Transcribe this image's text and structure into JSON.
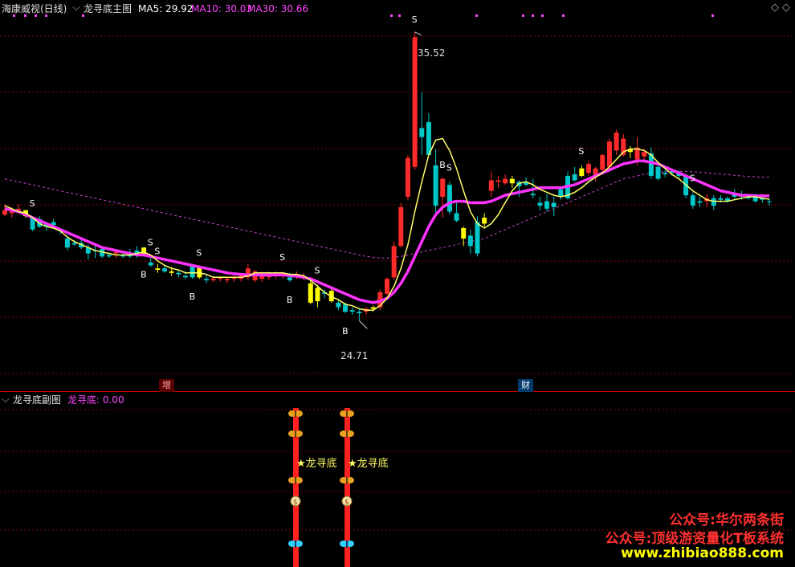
{
  "main_header": {
    "stock_label": "海康威视(日线)",
    "indicator_name": "龙寻底主图",
    "ma5_label": "MA5: 29.92",
    "ma10_label": "MA10: 30.03",
    "ma30_label": "MA30: 30.66"
  },
  "sub_header": {
    "indicator_name": "龙寻底副图",
    "value_label": "龙寻底: 0.00"
  },
  "markers": {
    "high_label": "35.52",
    "low_label": "24.71",
    "zeng_badge": "增",
    "cai_badge": "财",
    "sub_label_1": "★龙寻底",
    "sub_label_2": "★龙寻底"
  },
  "watermark": {
    "line1": "公众号:华尔两条街",
    "line2": "公众号:顶级游资量化T板系统",
    "line3": "www.zhibiao888.com"
  },
  "colors": {
    "up": "#ff2a2a",
    "down": "#00c8c8",
    "yellow_candle": "#ffff00",
    "ma5": "#ffff66",
    "ma10": "#ff33ff",
    "ma30": "#cc44cc",
    "grid": "#8b0000",
    "header_purple": "#ff44ff",
    "watermark_red": "#ff3030",
    "watermark_yellow": "#ffff00"
  },
  "chart_data": {
    "type": "candlestick",
    "title": "龙寻底主图",
    "ylim": [
      24,
      36
    ],
    "candles": [
      {
        "o": 29.55,
        "h": 29.75,
        "l": 29.35,
        "c": 29.4,
        "t": "up"
      },
      {
        "o": 29.5,
        "h": 29.65,
        "l": 29.3,
        "c": 29.45,
        "t": "up"
      },
      {
        "o": 29.55,
        "h": 29.75,
        "l": 29.5,
        "c": 29.6,
        "t": "up"
      },
      {
        "o": 29.35,
        "h": 29.55,
        "l": 29.3,
        "c": 29.55,
        "t": "yellow"
      },
      {
        "o": 29.3,
        "h": 29.3,
        "l": 28.85,
        "c": 28.9,
        "t": "down"
      },
      {
        "o": 29.25,
        "h": 29.35,
        "l": 28.95,
        "c": 29.0,
        "t": "down"
      },
      {
        "o": 29.0,
        "h": 29.15,
        "l": 28.85,
        "c": 29.1,
        "t": "down"
      },
      {
        "o": 29.15,
        "h": 29.25,
        "l": 28.95,
        "c": 29.05,
        "t": "down"
      },
      {
        "o": 28.9,
        "h": 28.95,
        "l": 28.75,
        "c": 28.85,
        "t": "down"
      },
      {
        "o": 28.6,
        "h": 28.7,
        "l": 28.2,
        "c": 28.3,
        "t": "down"
      },
      {
        "o": 28.45,
        "h": 28.55,
        "l": 28.35,
        "c": 28.4,
        "t": "down"
      },
      {
        "o": 28.45,
        "h": 28.6,
        "l": 28.25,
        "c": 28.3,
        "t": "down"
      },
      {
        "o": 28.3,
        "h": 28.4,
        "l": 27.9,
        "c": 28.1,
        "t": "down"
      },
      {
        "o": 28.2,
        "h": 28.4,
        "l": 27.95,
        "c": 28.2,
        "t": "down"
      },
      {
        "o": 28.25,
        "h": 28.3,
        "l": 27.95,
        "c": 28.0,
        "t": "down"
      },
      {
        "o": 28.05,
        "h": 28.15,
        "l": 27.95,
        "c": 28.0,
        "t": "down"
      },
      {
        "o": 28.1,
        "h": 28.2,
        "l": 27.95,
        "c": 28.15,
        "t": "up"
      },
      {
        "o": 28.05,
        "h": 28.1,
        "l": 27.95,
        "c": 28.0,
        "t": "down"
      },
      {
        "o": 28.1,
        "h": 28.25,
        "l": 27.95,
        "c": 28.0,
        "t": "down"
      },
      {
        "o": 28.1,
        "h": 28.35,
        "l": 27.95,
        "c": 28.2,
        "t": "down"
      },
      {
        "o": 28.05,
        "h": 28.3,
        "l": 28.0,
        "c": 28.3,
        "t": "yellow"
      },
      {
        "o": 27.8,
        "h": 28.0,
        "l": 27.65,
        "c": 27.7,
        "t": "down"
      },
      {
        "o": 27.6,
        "h": 27.75,
        "l": 27.45,
        "c": 27.55,
        "t": "yellow"
      },
      {
        "o": 27.6,
        "h": 27.7,
        "l": 27.45,
        "c": 27.5,
        "t": "down"
      },
      {
        "o": 27.5,
        "h": 27.65,
        "l": 27.35,
        "c": 27.45,
        "t": "yellow"
      },
      {
        "o": 27.45,
        "h": 27.55,
        "l": 27.3,
        "c": 27.4,
        "t": "down"
      },
      {
        "o": 27.35,
        "h": 27.5,
        "l": 27.25,
        "c": 27.3,
        "t": "down"
      },
      {
        "o": 27.3,
        "h": 27.75,
        "l": 27.25,
        "c": 27.7,
        "t": "down"
      },
      {
        "o": 27.65,
        "h": 27.7,
        "l": 27.25,
        "c": 27.3,
        "t": "yellow"
      },
      {
        "o": 27.25,
        "h": 27.4,
        "l": 27.1,
        "c": 27.2,
        "t": "down"
      },
      {
        "o": 27.2,
        "h": 27.35,
        "l": 27.15,
        "c": 27.25,
        "t": "up"
      },
      {
        "o": 27.25,
        "h": 27.35,
        "l": 27.15,
        "c": 27.3,
        "t": "up"
      },
      {
        "o": 27.2,
        "h": 27.3,
        "l": 27.1,
        "c": 27.25,
        "t": "up"
      },
      {
        "o": 27.25,
        "h": 27.4,
        "l": 27.15,
        "c": 27.3,
        "t": "up"
      },
      {
        "o": 27.25,
        "h": 27.45,
        "l": 27.15,
        "c": 27.35,
        "t": "up"
      },
      {
        "o": 27.3,
        "h": 27.75,
        "l": 27.2,
        "c": 27.6,
        "t": "up"
      },
      {
        "o": 27.2,
        "h": 27.55,
        "l": 27.15,
        "c": 27.5,
        "t": "up"
      },
      {
        "o": 27.25,
        "h": 27.5,
        "l": 27.15,
        "c": 27.4,
        "t": "up"
      },
      {
        "o": 27.3,
        "h": 27.5,
        "l": 27.2,
        "c": 27.4,
        "t": "up"
      },
      {
        "o": 27.35,
        "h": 27.5,
        "l": 27.25,
        "c": 27.4,
        "t": "up"
      },
      {
        "o": 27.35,
        "h": 27.5,
        "l": 27.25,
        "c": 27.45,
        "t": "up"
      },
      {
        "o": 27.3,
        "h": 27.45,
        "l": 27.15,
        "c": 27.2,
        "t": "down"
      },
      {
        "o": 27.35,
        "h": 27.5,
        "l": 27.25,
        "c": 27.4,
        "t": "up"
      },
      {
        "o": 27.3,
        "h": 27.45,
        "l": 27.2,
        "c": 27.35,
        "t": "up"
      },
      {
        "o": 27.1,
        "h": 27.3,
        "l": 26.4,
        "c": 26.45,
        "t": "yellow"
      },
      {
        "o": 26.95,
        "h": 27.05,
        "l": 26.3,
        "c": 26.5,
        "t": "yellow"
      },
      {
        "o": 26.8,
        "h": 26.9,
        "l": 26.6,
        "c": 26.75,
        "t": "down"
      },
      {
        "o": 26.85,
        "h": 26.95,
        "l": 26.45,
        "c": 26.5,
        "t": "yellow"
      },
      {
        "o": 26.45,
        "h": 26.55,
        "l": 26.2,
        "c": 26.3,
        "t": "down"
      },
      {
        "o": 26.4,
        "h": 26.45,
        "l": 26.1,
        "c": 26.15,
        "t": "down"
      },
      {
        "o": 26.2,
        "h": 26.3,
        "l": 26.05,
        "c": 26.15,
        "t": "down"
      },
      {
        "o": 26.15,
        "h": 26.25,
        "l": 25.85,
        "c": 26.1,
        "t": "down"
      },
      {
        "o": 26.15,
        "h": 26.3,
        "l": 26.05,
        "c": 26.25,
        "t": "up"
      },
      {
        "o": 26.25,
        "h": 26.35,
        "l": 26.15,
        "c": 26.3,
        "t": "yellow"
      },
      {
        "o": 26.3,
        "h": 26.9,
        "l": 26.2,
        "c": 26.8,
        "t": "up"
      },
      {
        "o": 26.75,
        "h": 27.3,
        "l": 26.7,
        "c": 27.25,
        "t": "up"
      },
      {
        "o": 27.3,
        "h": 28.5,
        "l": 27.2,
        "c": 28.35,
        "t": "up"
      },
      {
        "o": 28.35,
        "h": 29.8,
        "l": 28.3,
        "c": 29.65,
        "t": "up"
      },
      {
        "o": 30.0,
        "h": 31.4,
        "l": 29.9,
        "c": 31.3,
        "t": "up"
      },
      {
        "o": 31.0,
        "h": 35.52,
        "l": 30.9,
        "c": 35.35,
        "t": "up"
      },
      {
        "o": 32.3,
        "h": 33.5,
        "l": 31.4,
        "c": 32.0,
        "t": "down"
      },
      {
        "o": 32.5,
        "h": 32.8,
        "l": 31.35,
        "c": 31.4,
        "t": "down"
      },
      {
        "o": 31.05,
        "h": 31.6,
        "l": 29.4,
        "c": 29.7,
        "t": "down"
      },
      {
        "o": 30.0,
        "h": 30.65,
        "l": 29.3,
        "c": 30.6,
        "t": "up"
      },
      {
        "o": 30.4,
        "h": 30.5,
        "l": 29.4,
        "c": 29.5,
        "t": "down"
      },
      {
        "o": 29.45,
        "h": 29.8,
        "l": 29.15,
        "c": 29.2,
        "t": "down"
      },
      {
        "o": 28.95,
        "h": 29.0,
        "l": 28.35,
        "c": 28.6,
        "t": "yellow"
      },
      {
        "o": 28.7,
        "h": 28.9,
        "l": 28.1,
        "c": 28.35,
        "t": "down"
      },
      {
        "o": 28.1,
        "h": 29.35,
        "l": 28.0,
        "c": 29.15,
        "t": "down"
      },
      {
        "o": 29.3,
        "h": 29.45,
        "l": 29.0,
        "c": 29.1,
        "t": "yellow"
      },
      {
        "o": 30.2,
        "h": 30.85,
        "l": 30.0,
        "c": 30.55,
        "t": "up"
      },
      {
        "o": 30.55,
        "h": 30.7,
        "l": 30.3,
        "c": 30.5,
        "t": "up"
      },
      {
        "o": 30.45,
        "h": 30.75,
        "l": 30.4,
        "c": 30.6,
        "t": "up"
      },
      {
        "o": 30.6,
        "h": 30.7,
        "l": 30.3,
        "c": 30.45,
        "t": "yellow"
      },
      {
        "o": 30.5,
        "h": 30.55,
        "l": 30.0,
        "c": 30.35,
        "t": "down"
      },
      {
        "o": 30.4,
        "h": 30.65,
        "l": 30.35,
        "c": 30.5,
        "t": "down"
      },
      {
        "o": 30.1,
        "h": 30.6,
        "l": 29.95,
        "c": 30.05,
        "t": "down"
      },
      {
        "o": 29.8,
        "h": 30.0,
        "l": 29.55,
        "c": 29.7,
        "t": "down"
      },
      {
        "o": 29.85,
        "h": 30.1,
        "l": 29.5,
        "c": 29.6,
        "t": "down"
      },
      {
        "o": 29.65,
        "h": 30.0,
        "l": 29.35,
        "c": 29.8,
        "t": "down"
      },
      {
        "o": 30.0,
        "h": 30.35,
        "l": 29.9,
        "c": 30.25,
        "t": "down"
      },
      {
        "o": 29.95,
        "h": 30.85,
        "l": 29.9,
        "c": 30.7,
        "t": "down"
      },
      {
        "o": 30.75,
        "h": 31.0,
        "l": 30.5,
        "c": 30.55,
        "t": "down"
      },
      {
        "o": 30.7,
        "h": 31.05,
        "l": 30.65,
        "c": 30.95,
        "t": "yellow"
      },
      {
        "o": 30.8,
        "h": 31.2,
        "l": 30.7,
        "c": 31.1,
        "t": "up"
      },
      {
        "o": 30.7,
        "h": 31.0,
        "l": 30.5,
        "c": 30.95,
        "t": "up"
      },
      {
        "o": 30.9,
        "h": 31.45,
        "l": 30.8,
        "c": 31.4,
        "t": "up"
      },
      {
        "o": 31.0,
        "h": 31.95,
        "l": 30.95,
        "c": 31.85,
        "t": "up"
      },
      {
        "o": 31.55,
        "h": 32.25,
        "l": 31.4,
        "c": 32.15,
        "t": "up"
      },
      {
        "o": 31.4,
        "h": 32.1,
        "l": 31.35,
        "c": 31.95,
        "t": "up"
      },
      {
        "o": 31.5,
        "h": 31.7,
        "l": 31.3,
        "c": 31.6,
        "t": "yellow"
      },
      {
        "o": 31.65,
        "h": 32.0,
        "l": 31.05,
        "c": 31.25,
        "t": "up"
      },
      {
        "o": 31.35,
        "h": 31.6,
        "l": 31.25,
        "c": 31.5,
        "t": "up"
      },
      {
        "o": 31.45,
        "h": 31.65,
        "l": 30.6,
        "c": 30.7,
        "t": "down"
      },
      {
        "o": 31.0,
        "h": 31.15,
        "l": 30.55,
        "c": 30.6,
        "t": "down"
      },
      {
        "o": 30.8,
        "h": 30.9,
        "l": 30.65,
        "c": 30.75,
        "t": "down"
      },
      {
        "o": 30.85,
        "h": 30.95,
        "l": 30.7,
        "c": 30.8,
        "t": "down"
      },
      {
        "o": 30.8,
        "h": 30.9,
        "l": 30.6,
        "c": 30.7,
        "t": "down"
      },
      {
        "o": 30.7,
        "h": 30.75,
        "l": 29.95,
        "c": 30.05,
        "t": "down"
      },
      {
        "o": 30.05,
        "h": 30.15,
        "l": 29.6,
        "c": 29.7,
        "t": "down"
      },
      {
        "o": 29.85,
        "h": 30.0,
        "l": 29.65,
        "c": 29.8,
        "t": "down"
      },
      {
        "o": 29.85,
        "h": 30.1,
        "l": 29.65,
        "c": 29.95,
        "t": "up"
      },
      {
        "o": 29.95,
        "h": 30.05,
        "l": 29.55,
        "c": 29.7,
        "t": "down"
      },
      {
        "o": 29.95,
        "h": 30.05,
        "l": 29.8,
        "c": 29.9,
        "t": "down"
      },
      {
        "o": 29.85,
        "h": 30.0,
        "l": 29.8,
        "c": 29.95,
        "t": "down"
      },
      {
        "o": 30.0,
        "h": 30.25,
        "l": 29.9,
        "c": 30.1,
        "t": "down"
      },
      {
        "o": 30.0,
        "h": 30.2,
        "l": 29.9,
        "c": 30.05,
        "t": "down"
      },
      {
        "o": 29.95,
        "h": 30.1,
        "l": 29.9,
        "c": 30.0,
        "t": "down"
      },
      {
        "o": 30.05,
        "h": 30.1,
        "l": 29.8,
        "c": 29.85,
        "t": "down"
      },
      {
        "o": 29.95,
        "h": 30.05,
        "l": 29.8,
        "c": 29.9,
        "t": "down"
      },
      {
        "o": 29.85,
        "h": 29.95,
        "l": 29.7,
        "c": 29.85,
        "t": "down"
      }
    ],
    "ma5": [
      29.7,
      29.6,
      29.5,
      29.45,
      29.3,
      29.1,
      29.0,
      28.95,
      28.85,
      28.65,
      28.5,
      28.4,
      28.3,
      28.2,
      28.15,
      28.1,
      28.05,
      28.05,
      28.05,
      28.1,
      28.15,
      28.05,
      27.85,
      27.7,
      27.6,
      27.55,
      27.45,
      27.45,
      27.45,
      27.4,
      27.3,
      27.3,
      27.3,
      27.3,
      27.3,
      27.35,
      27.45,
      27.45,
      27.45,
      27.45,
      27.45,
      27.4,
      27.4,
      27.35,
      27.2,
      27.0,
      26.8,
      26.65,
      26.55,
      26.4,
      26.35,
      26.25,
      26.2,
      26.2,
      26.35,
      26.6,
      27.0,
      27.6,
      28.4,
      29.5,
      30.5,
      31.4,
      31.9,
      31.95,
      31.55,
      30.95,
      30.2,
      29.5,
      29.1,
      28.95,
      29.1,
      29.4,
      29.8,
      30.2,
      30.45,
      30.5,
      30.4,
      30.25,
      30.15,
      30.05,
      30.0,
      30.05,
      30.15,
      30.3,
      30.5,
      30.65,
      30.8,
      31.0,
      31.25,
      31.5,
      31.6,
      31.6,
      31.55,
      31.4,
      31.15,
      30.95,
      30.75,
      30.6,
      30.4,
      30.2,
      30.05,
      29.9,
      29.85,
      29.85,
      29.85,
      29.9,
      29.95,
      30.0,
      30.0,
      29.95,
      29.92
    ],
    "ma10": [
      29.6,
      29.55,
      29.5,
      29.4,
      29.3,
      29.2,
      29.1,
      29.0,
      28.9,
      28.8,
      28.7,
      28.6,
      28.5,
      28.4,
      28.3,
      28.25,
      28.2,
      28.15,
      28.1,
      28.05,
      28.05,
      28.0,
      27.95,
      27.9,
      27.85,
      27.8,
      27.75,
      27.7,
      27.65,
      27.6,
      27.55,
      27.5,
      27.45,
      27.42,
      27.4,
      27.38,
      27.38,
      27.38,
      27.38,
      27.38,
      27.38,
      27.36,
      27.34,
      27.3,
      27.25,
      27.15,
      27.05,
      26.95,
      26.85,
      26.75,
      26.65,
      26.55,
      26.5,
      26.45,
      26.5,
      26.6,
      26.8,
      27.1,
      27.5,
      28.0,
      28.5,
      29.0,
      29.4,
      29.65,
      29.8,
      29.85,
      29.85,
      29.8,
      29.8,
      29.8,
      29.85,
      29.95,
      30.05,
      30.1,
      30.15,
      30.2,
      30.25,
      30.3,
      30.3,
      30.3,
      30.3,
      30.35,
      30.4,
      30.5,
      30.6,
      30.7,
      30.8,
      30.9,
      31.0,
      31.1,
      31.15,
      31.2,
      31.2,
      31.15,
      31.1,
      31.0,
      30.9,
      30.8,
      30.7,
      30.6,
      30.5,
      30.4,
      30.3,
      30.2,
      30.15,
      30.1,
      30.05,
      30.05,
      30.03,
      30.03,
      30.03
    ],
    "ma30": [
      30.6,
      30.55,
      30.5,
      30.45,
      30.4,
      30.35,
      30.3,
      30.25,
      30.2,
      30.15,
      30.1,
      30.05,
      30.0,
      29.95,
      29.9,
      29.85,
      29.8,
      29.75,
      29.7,
      29.65,
      29.6,
      29.55,
      29.5,
      29.45,
      29.4,
      29.35,
      29.3,
      29.25,
      29.2,
      29.15,
      29.1,
      29.05,
      29.0,
      28.95,
      28.9,
      28.85,
      28.8,
      28.75,
      28.7,
      28.65,
      28.6,
      28.55,
      28.5,
      28.45,
      28.4,
      28.35,
      28.3,
      28.25,
      28.2,
      28.15,
      28.1,
      28.05,
      28.0,
      27.97,
      27.95,
      27.95,
      27.97,
      28.0,
      28.05,
      28.1,
      28.15,
      28.2,
      28.25,
      28.3,
      28.35,
      28.4,
      28.45,
      28.5,
      28.55,
      28.6,
      28.7,
      28.8,
      28.9,
      29.0,
      29.1,
      29.2,
      29.3,
      29.4,
      29.5,
      29.6,
      29.7,
      29.8,
      29.9,
      30.0,
      30.1,
      30.2,
      30.3,
      30.4,
      30.5,
      30.6,
      30.65,
      30.7,
      30.75,
      30.8,
      30.82,
      30.84,
      30.85,
      30.85,
      30.85,
      30.84,
      30.82,
      30.8,
      30.78,
      30.76,
      30.74,
      30.72,
      30.7,
      30.68,
      30.67,
      30.66,
      30.66
    ],
    "b_marks": [
      20,
      27,
      41,
      49
    ],
    "s_marks": [
      4,
      21,
      40,
      45,
      64,
      83,
      99
    ],
    "rebound_marks": [
      22,
      28,
      59,
      63
    ]
  }
}
